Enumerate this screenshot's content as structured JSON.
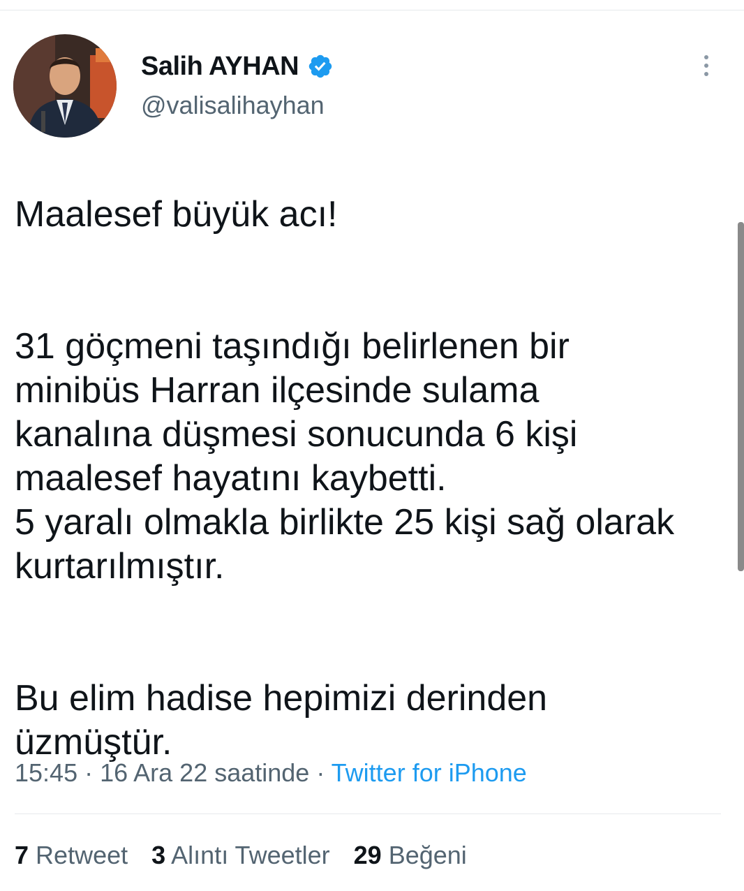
{
  "author": {
    "display_name": "Salih AYHAN",
    "handle": "@valisalihayhan",
    "verified": true
  },
  "tweet": {
    "paragraphs": [
      "Maalesef büyük acı!",
      "31 göçmeni taşındığı belirlenen bir minibüs Harran ilçesinde sulama kanalına düşmesi sonucunda 6 kişi maalesef hayatını kaybetti.\n5 yaralı olmakla birlikte 25 kişi sağ olarak kurtarılmıştır.",
      "Bu elim hadise hepimizi derinden üzmüştür."
    ]
  },
  "meta": {
    "time": "15:45",
    "separator1": " · ",
    "date": "16 Ara 22 saatinde",
    "separator2": " · ",
    "source": "Twitter for iPhone"
  },
  "stats": {
    "retweets": {
      "count": "7",
      "label": "Retweet"
    },
    "quotes": {
      "count": "3",
      "label": "Alıntı Tweetler"
    },
    "likes": {
      "count": "29",
      "label": "Beğeni"
    }
  },
  "colors": {
    "text_primary": "#0f1419",
    "text_secondary": "#536471",
    "link": "#1d9bf0",
    "verified": "#1d9bf0",
    "divider": "#e6e9ec"
  },
  "icons": {
    "verified": "verified-badge-icon",
    "more": "more-vertical-icon"
  }
}
